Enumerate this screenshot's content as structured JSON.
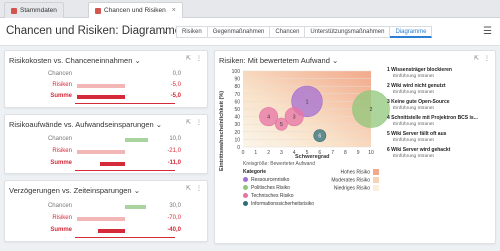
{
  "tabs": [
    {
      "label": "Stammdaten"
    },
    {
      "label": "Chancen und Risiken"
    }
  ],
  "header": {
    "title": "Chancen und Risiken: Diagramme"
  },
  "nav": [
    {
      "label": "Risiken"
    },
    {
      "label": "Gegenmaßnahmen"
    },
    {
      "label": "Chancen"
    },
    {
      "label": "Unterstützungsmaßnahmen"
    },
    {
      "label": "Diagramme"
    }
  ],
  "cards": [
    {
      "title": "Risikokosten vs. Chanceneinnahmen",
      "rows": [
        {
          "label": "Chancen",
          "value": "0,0"
        },
        {
          "label": "Risiken",
          "value": "-5,0"
        },
        {
          "label": "Summe",
          "value": "-5,0"
        }
      ],
      "bars": {
        "chancen": 0,
        "risiken": 5,
        "summe": 5,
        "max": 5
      }
    },
    {
      "title": "Risikoaufwände vs. Aufwandseinsparungen",
      "rows": [
        {
          "label": "Chancen",
          "value": "10,0"
        },
        {
          "label": "Risiken",
          "value": "-21,0"
        },
        {
          "label": "Summe",
          "value": "-11,0"
        }
      ],
      "bars": {
        "chancen": 10,
        "risiken": 21,
        "summe": 11,
        "max": 21
      }
    },
    {
      "title": "Verzögerungen vs. Zeiteinsparungen",
      "rows": [
        {
          "label": "Chancen",
          "value": "30,0"
        },
        {
          "label": "Risiken",
          "value": "-70,0"
        },
        {
          "label": "Summe",
          "value": "-40,0"
        }
      ],
      "bars": {
        "chancen": 30,
        "risiken": 70,
        "summe": 40,
        "max": 70
      }
    }
  ],
  "bubble": {
    "title": "Risiken: Mit bewertetem Aufwand",
    "ylabel": "Eintrittswahrscheinlichkeit (%)",
    "xlabel": "Schweregrad",
    "size_note": "Kreisgröße: Bewerteter Aufwand",
    "legend_title": "Kategorie",
    "legend": [
      {
        "label": "Ressourcenrisiko",
        "color": "#a46fd3"
      },
      {
        "label": "Politisches Risiko",
        "color": "#8fc77a"
      },
      {
        "label": "Technisches Risiko",
        "color": "#e773a4"
      },
      {
        "label": "Informationssicherheitsrisiko",
        "color": "#2f6d78"
      }
    ],
    "risk_legend": [
      {
        "label": "Hohes Risiko",
        "color": "#f2a98b"
      },
      {
        "label": "Moderates Risiko",
        "color": "#f6d3b7"
      },
      {
        "label": "Niedriges Risiko",
        "color": "#fbeedd"
      }
    ],
    "risks": [
      {
        "label": "1 Wissensträger blockieren",
        "sub": "Einführung Intranet"
      },
      {
        "label": "2 Wiki wird nicht genutzt",
        "sub": "Einführung Intranet"
      },
      {
        "label": "3 Keine gute Open-Source",
        "sub": "Einführung Intranet"
      },
      {
        "label": "4 Schnittstelle mit Projektron BCS is...",
        "sub": "Einführung Intranet"
      },
      {
        "label": "5 Wiki Server fällt oft aus",
        "sub": "Einführung Intranet"
      },
      {
        "label": "6 Wiki Server wird gehackt",
        "sub": "Einführung Intranet"
      }
    ]
  },
  "chart_data": {
    "type": "scatter",
    "title": "Risiken: Mit bewertetem Aufwand",
    "xlabel": "Schweregrad",
    "ylabel": "Eintrittswahrscheinlichkeit (%)",
    "xlim": [
      0,
      10
    ],
    "ylim": [
      0,
      100
    ],
    "x_ticks": [
      "0",
      "1",
      "2",
      "3",
      "4",
      "5",
      "6",
      "7",
      "8",
      "9",
      "10"
    ],
    "y_ticks": [
      "0",
      "10",
      "20",
      "30",
      "40",
      "50",
      "60",
      "70",
      "80",
      "90",
      "100"
    ],
    "points": [
      {
        "id": "1",
        "x": 5,
        "y": 60,
        "size": 8,
        "color": "#a46fd3"
      },
      {
        "id": "2",
        "x": 10,
        "y": 50,
        "size": 10,
        "color": "#8fc77a"
      },
      {
        "id": "3",
        "x": 4,
        "y": 40,
        "size": 4,
        "color": "#e773a4"
      },
      {
        "id": "4",
        "x": 2,
        "y": 40,
        "size": 4,
        "color": "#e773a4"
      },
      {
        "id": "5",
        "x": 3,
        "y": 30,
        "size": 2,
        "color": "#e773a4"
      },
      {
        "id": "6",
        "x": 6,
        "y": 15,
        "size": 2,
        "color": "#2f6d78"
      }
    ]
  }
}
